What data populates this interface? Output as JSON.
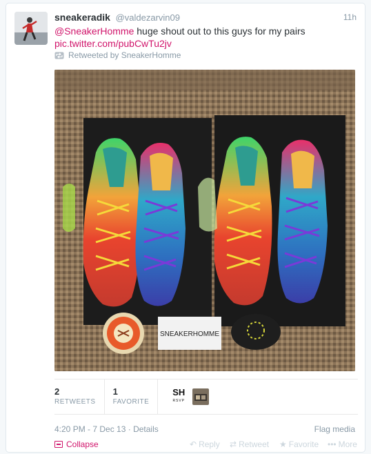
{
  "tweet": {
    "fullname": "sneakeradik",
    "handle": "@valdezarvin09",
    "time": "11h",
    "mention": "@SneakerHomme",
    "text_body": " huge shout out to this guys for my pairs",
    "link": "pic.twitter.com/pubCwTu2jv",
    "retweeted_by": "Retweeted by SneakerHomme",
    "photo_sign": "SNEAKERHOMME"
  },
  "stats": {
    "retweets_count": "2",
    "retweets_label": "RETWEETS",
    "favorites_count": "1",
    "favorites_label": "FAVORITE",
    "fav_logo_text": "SH",
    "fav_logo_sub": "RSVP"
  },
  "footer": {
    "timestamp": "4:20 PM - 7 Dec 13",
    "details": "Details",
    "flag": "Flag media",
    "collapse": "Collapse",
    "reply": "Reply",
    "retweet": "Retweet",
    "favorite": "Favorite",
    "more": "More"
  },
  "colors": {
    "accent": "#d0136a",
    "muted": "#8899a6",
    "faint": "#ccd6dd"
  }
}
